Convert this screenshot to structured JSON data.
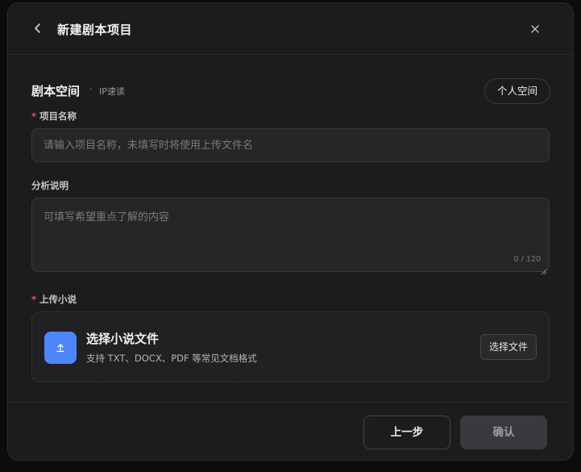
{
  "dialog": {
    "title": "新建剧本项目"
  },
  "space": {
    "title": "剧本空间",
    "separator": "·",
    "subtitle": "IP速读",
    "personal_button": "个人空间"
  },
  "form": {
    "project_name": {
      "required_mark": "*",
      "label": "项目名称",
      "placeholder": "请输入项目名称，未填写时将使用上传文件名",
      "value": ""
    },
    "analysis": {
      "label": "分析说明",
      "placeholder": "可填写希望重点了解的内容",
      "value": "",
      "counter": "0 / 120"
    },
    "upload": {
      "required_mark": "*",
      "label": "上传小说",
      "title": "选择小说文件",
      "description": "支持 TXT、DOCX、PDF 等常见文档格式",
      "choose_button": "选择文件",
      "icon": "upload-icon",
      "icon_bg": "#4d86f7"
    }
  },
  "footer": {
    "prev_button": "上一步",
    "confirm_button": "确认"
  },
  "icons": {
    "back": "chevron-left-icon",
    "close": "close-icon"
  }
}
